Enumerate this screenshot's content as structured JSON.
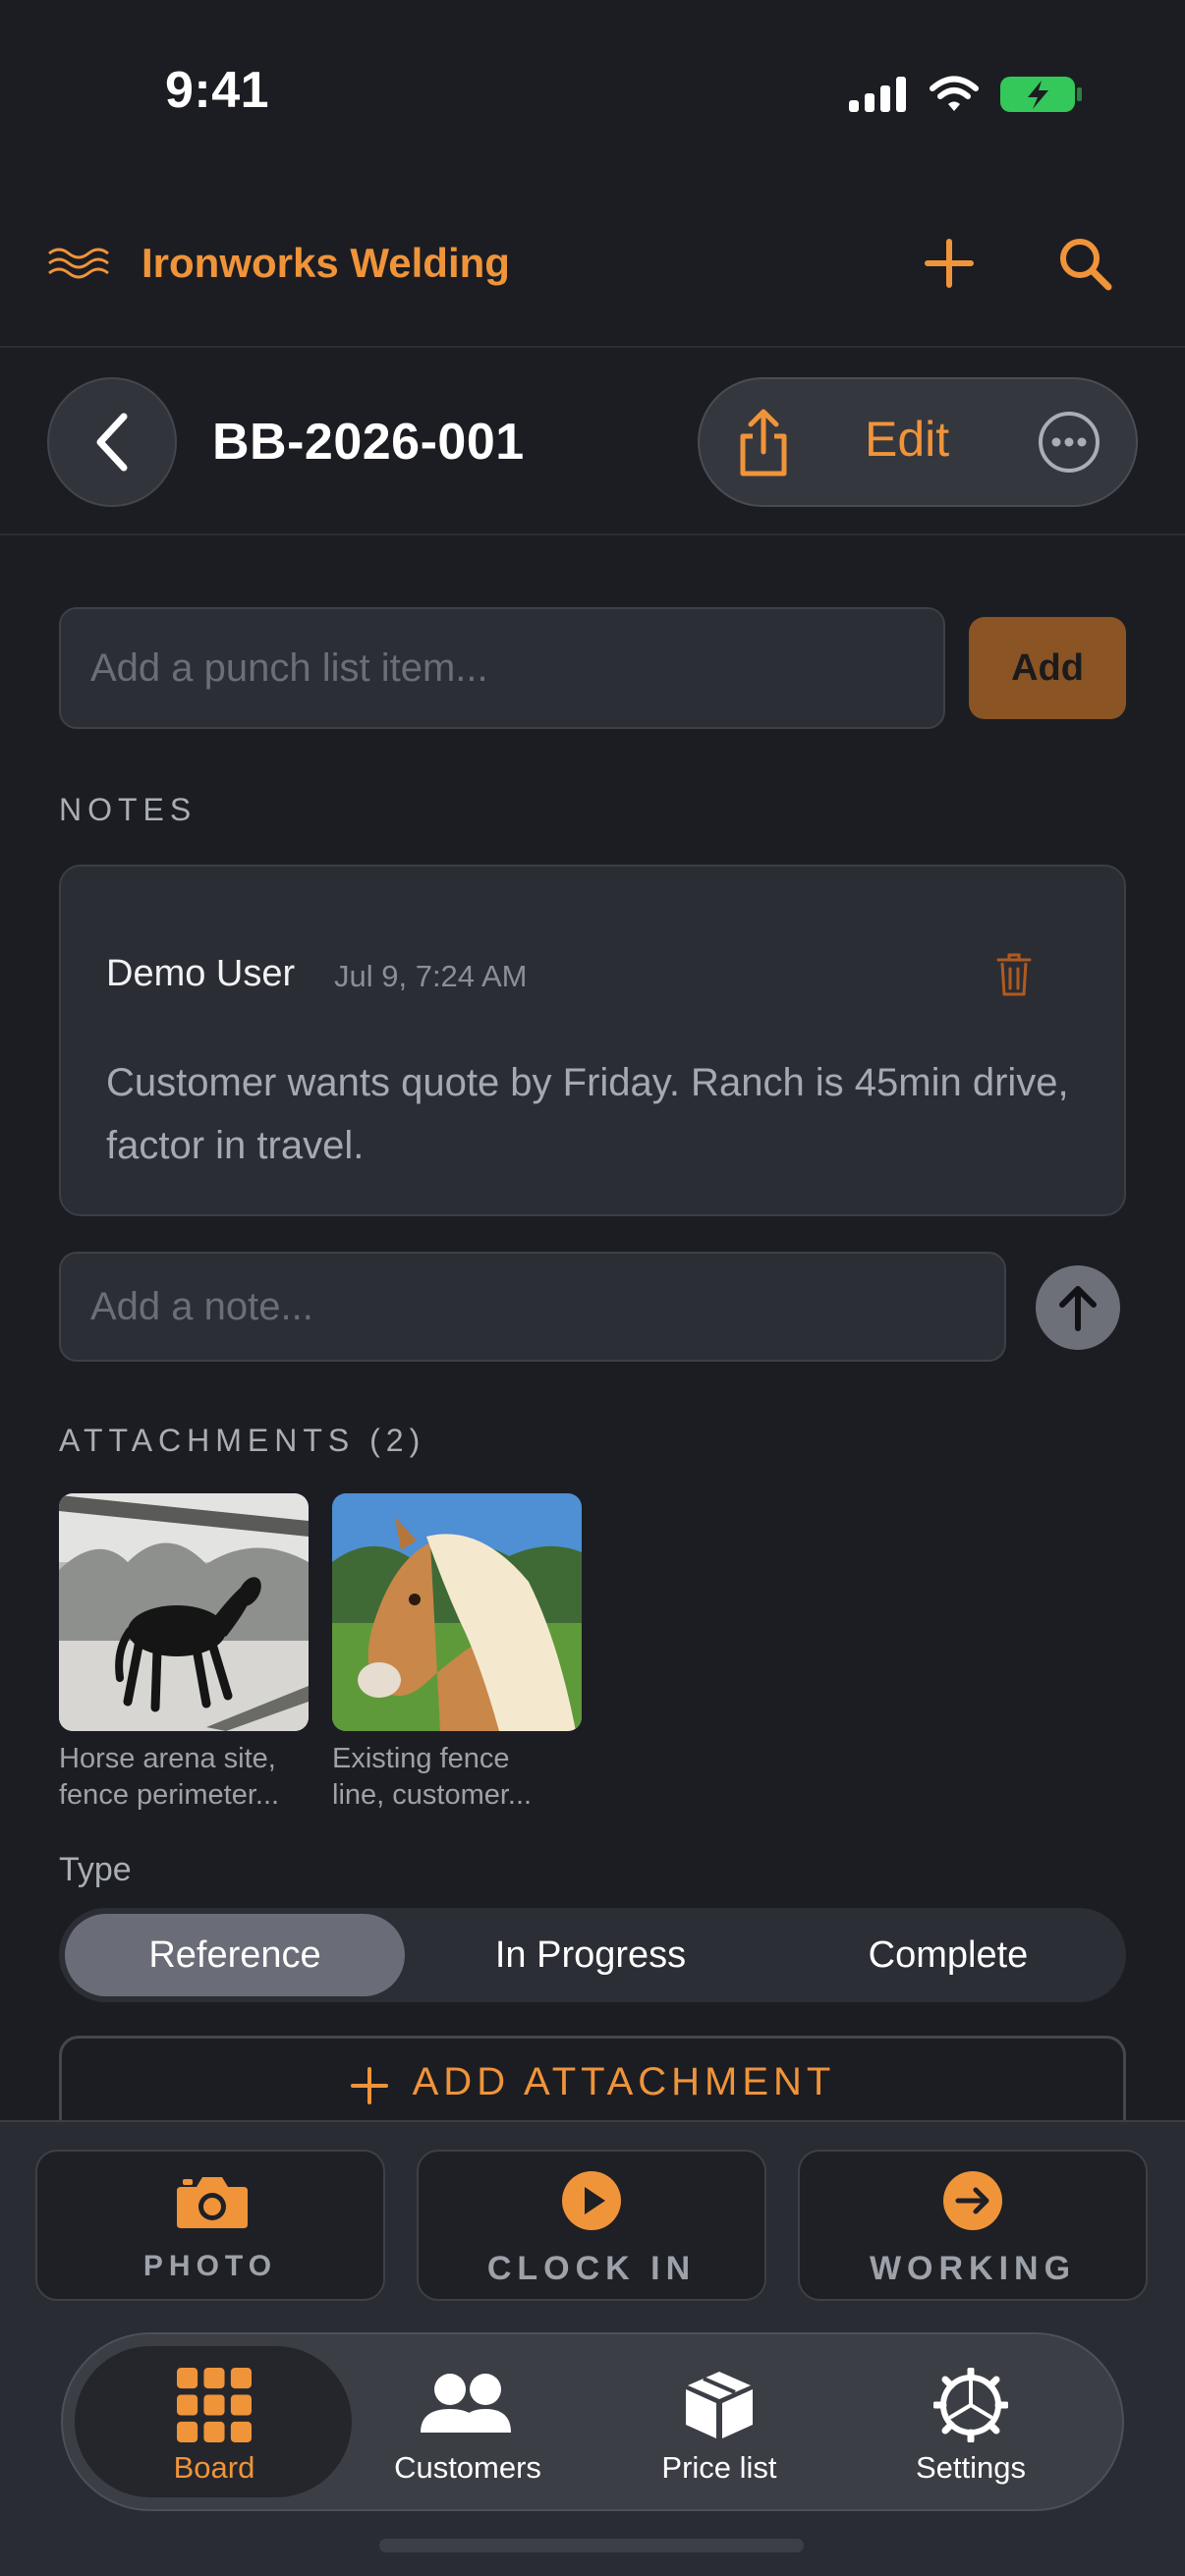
{
  "status_bar": {
    "time": "9:41"
  },
  "app": {
    "title": "Ironworks Welding"
  },
  "job": {
    "id": "BB-2026-001",
    "edit_label": "Edit"
  },
  "punch_list": {
    "placeholder": "Add a punch list item...",
    "add_label": "Add"
  },
  "notes": {
    "section_label": "NOTES",
    "items": [
      {
        "author": "Demo User",
        "time": "Jul 9, 7:24 AM",
        "body": "Customer wants quote by Friday. Ranch is 45min drive, factor in travel."
      }
    ],
    "input_placeholder": "Add a note..."
  },
  "attachments": {
    "section_label": "ATTACHMENTS (2)",
    "items": [
      {
        "caption_line1": "Horse arena site,",
        "caption_line2": "fence perimeter..."
      },
      {
        "caption_line1": "Existing fence",
        "caption_line2": "line, customer..."
      }
    ],
    "type_label": "Type",
    "type_options": [
      "Reference",
      "In Progress",
      "Complete"
    ],
    "selected_type": "Reference",
    "add_label": "ADD ATTACHMENT"
  },
  "quick_actions": [
    {
      "label": "PHOTO",
      "icon": "camera-icon"
    },
    {
      "label": "CLOCK IN",
      "icon": "play-icon"
    },
    {
      "label": "WORKING",
      "icon": "arrow-right-icon"
    }
  ],
  "tabs": [
    {
      "label": "Board",
      "icon": "grid-icon",
      "active": true
    },
    {
      "label": "Customers",
      "icon": "people-icon",
      "active": false
    },
    {
      "label": "Price list",
      "icon": "box-icon",
      "active": false
    },
    {
      "label": "Settings",
      "icon": "gear-icon",
      "active": false
    }
  ],
  "colors": {
    "accent": "#f0943a",
    "background": "#1c1d22"
  }
}
